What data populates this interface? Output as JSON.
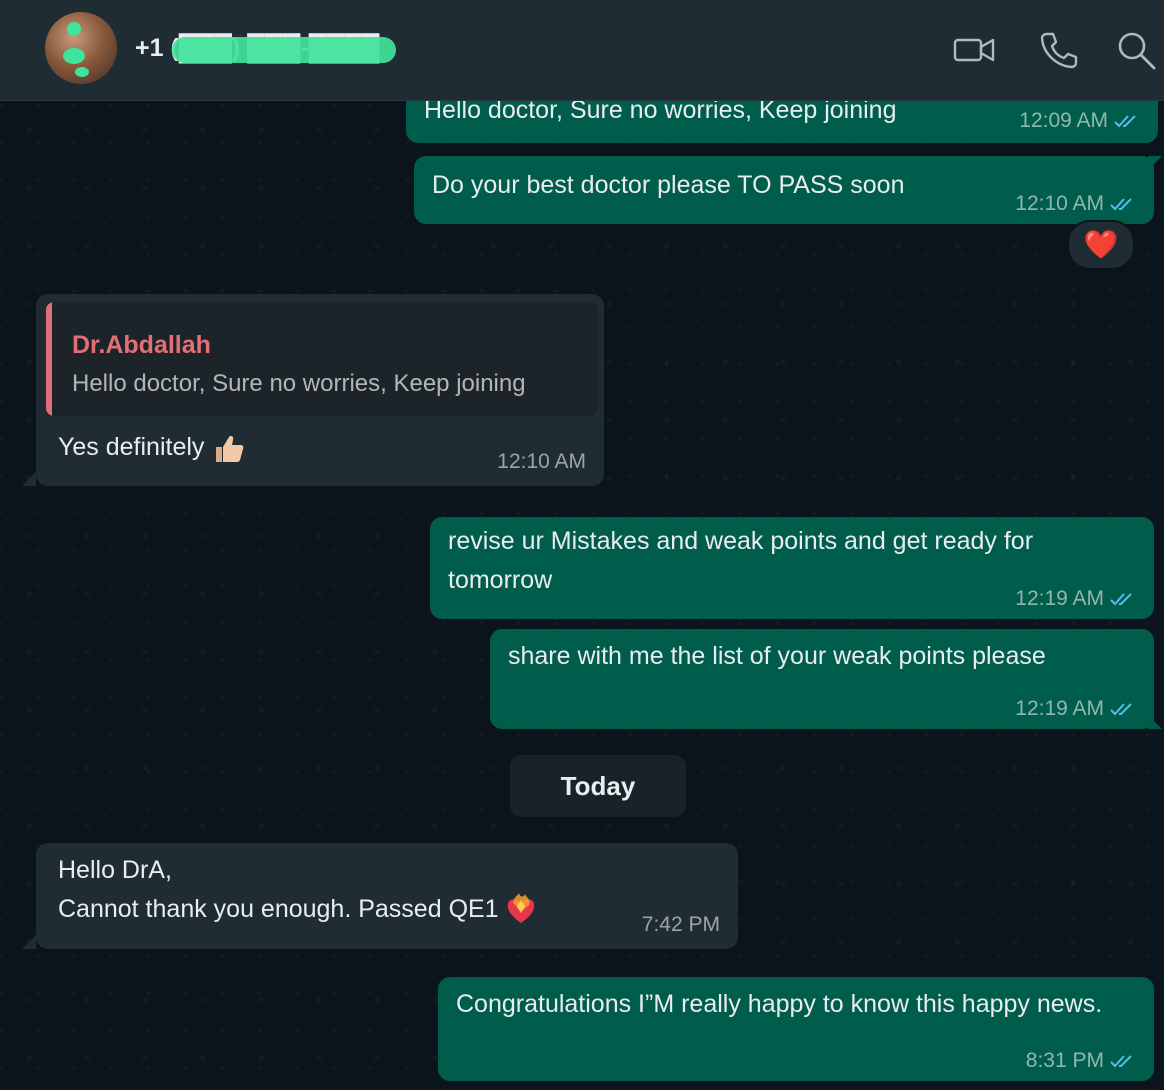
{
  "header": {
    "contact_name": "+1 (███) ███-████",
    "icons": [
      "video-call-icon",
      "voice-call-icon",
      "search-icon"
    ]
  },
  "messages": [
    {
      "direction": "out",
      "text": "Hello doctor, Sure no worries, Keep joining",
      "time": "12:09 AM",
      "status": "read"
    },
    {
      "direction": "out",
      "text": "Do your best doctor please TO PASS soon",
      "time": "12:10 AM",
      "status": "read",
      "reaction": "❤️"
    },
    {
      "direction": "in",
      "quote": {
        "author": "Dr.Abdallah",
        "text": "Hello doctor, Sure no worries, Keep joining"
      },
      "text": "Yes definitely",
      "emoji": "thumbs-up",
      "time": "12:10 AM"
    },
    {
      "direction": "out",
      "text": "revise ur Mistakes and weak points and get ready for tomorrow",
      "time": "12:19 AM",
      "status": "read"
    },
    {
      "direction": "out",
      "text": "share with me the list of your weak points please",
      "time": "12:19 AM",
      "status": "read"
    },
    {
      "direction": "in",
      "text": "Hello DrA,\nCannot thank you enough. Passed QE1",
      "emoji": "heart-on-fire",
      "time": "7:42 PM"
    },
    {
      "direction": "out",
      "text": "Congratulations I”M really happy to know this happy news.",
      "time": "8:31 PM",
      "status": "read"
    }
  ],
  "day_separator": "Today",
  "colors": {
    "header_bg": "#202c33",
    "chat_bg": "#0b141a",
    "outgoing_bubble": "#005c4b",
    "incoming_bubble": "#202c33",
    "quote_author": "#e36f76",
    "read_ticks": "#53bdeb"
  }
}
